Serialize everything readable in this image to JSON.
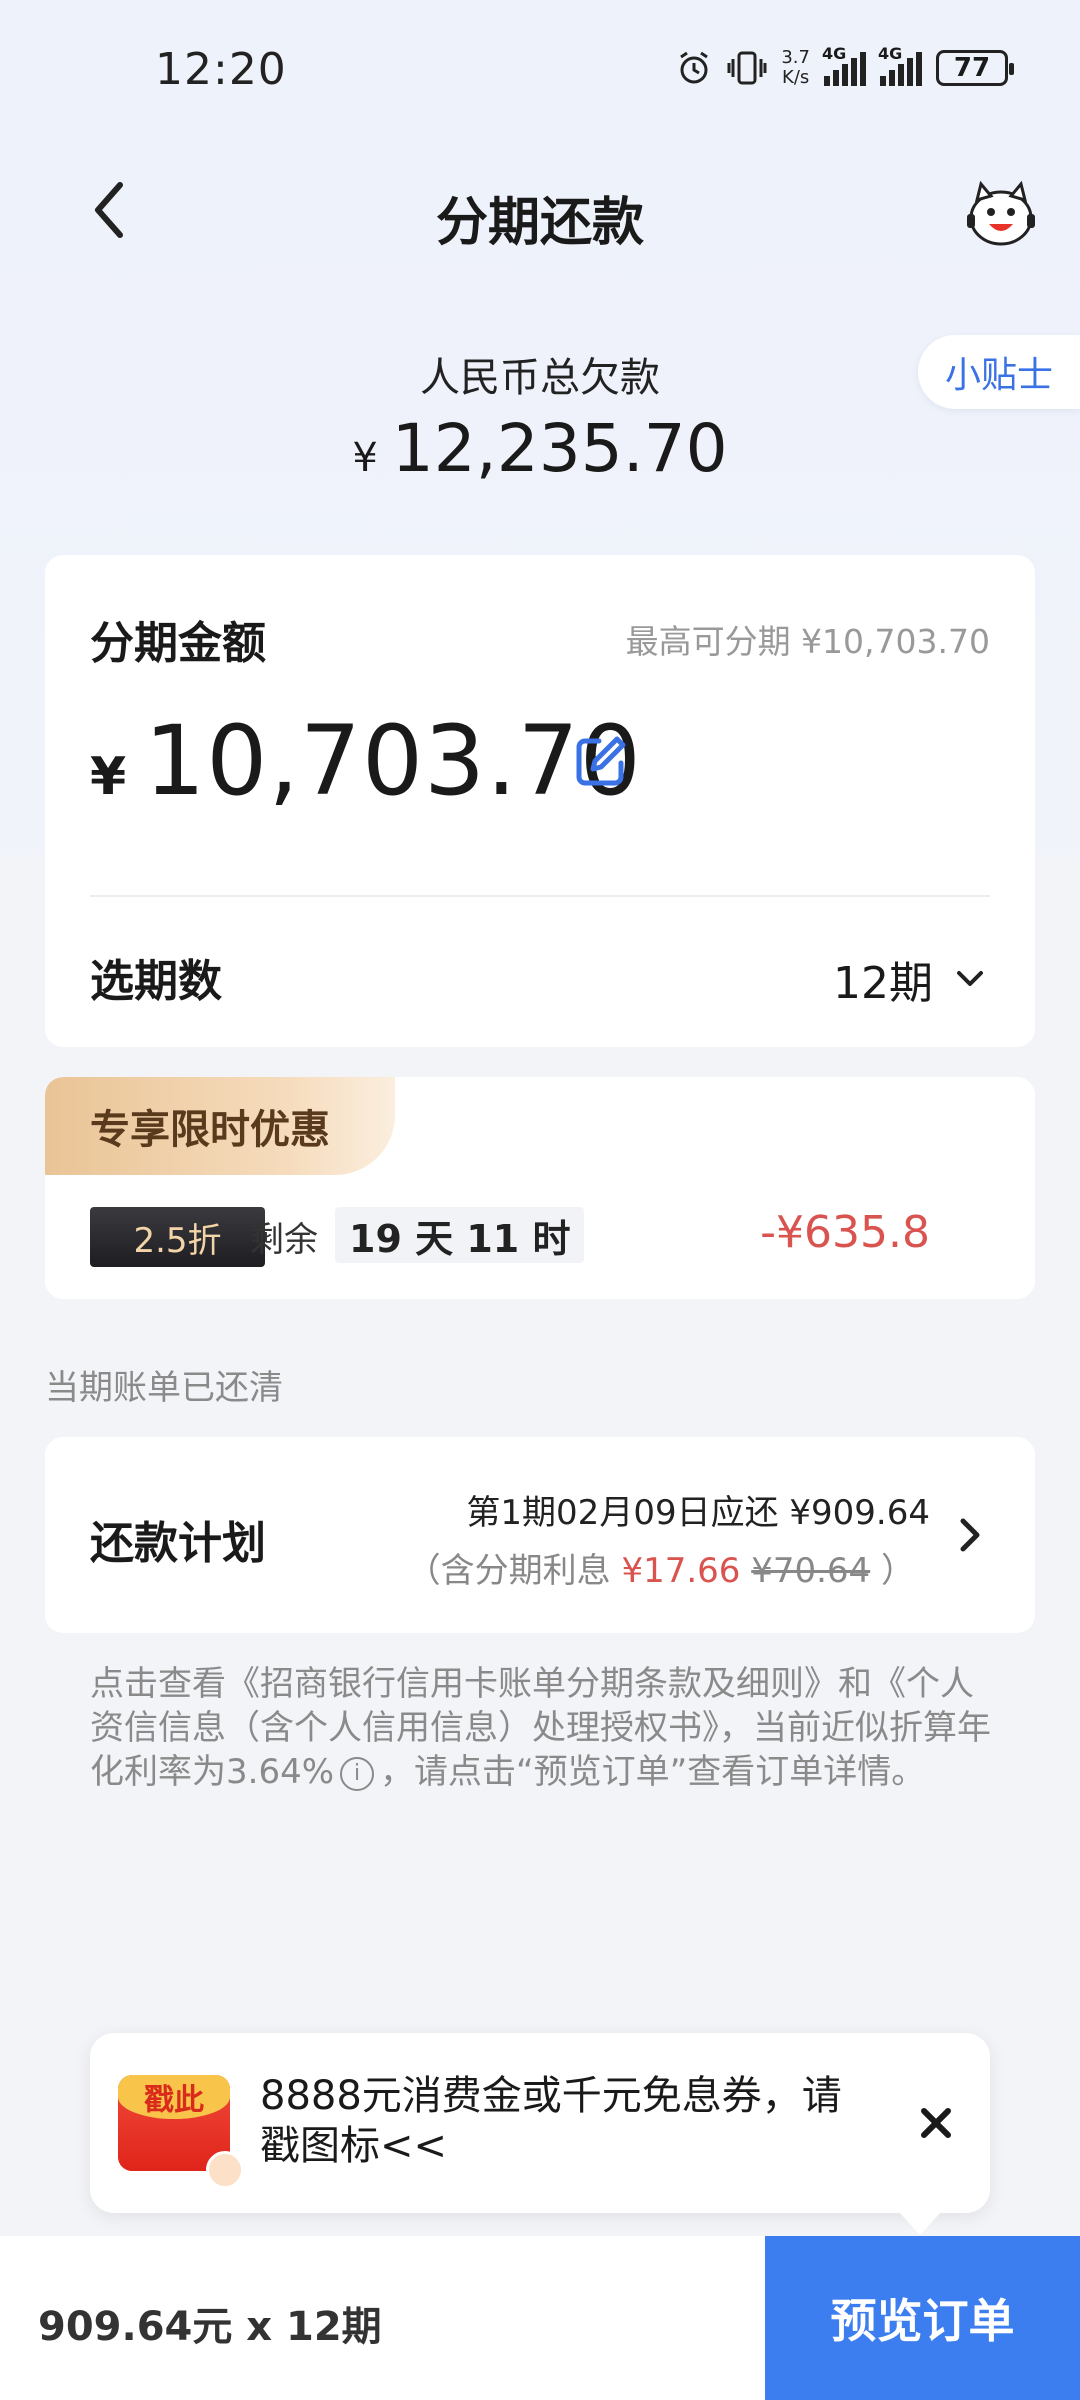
{
  "status_bar": {
    "time": "12:20",
    "net_speed_top": "3.7",
    "net_speed_unit": "K/s",
    "signal1_label": "4G",
    "signal2_label": "4G",
    "battery": "77"
  },
  "header": {
    "title": "分期还款"
  },
  "summary": {
    "debt_label": "人民币总欠款",
    "currency": "¥",
    "debt_amount": "12,235.70",
    "tips_label": "小贴士"
  },
  "installment": {
    "label": "分期金额",
    "max_text": "最高可分期 ¥10,703.70",
    "currency": "¥",
    "amount": "10,703.70",
    "period_label": "选期数",
    "period_value": "12期"
  },
  "promo": {
    "tag": "专享限时优惠",
    "discount": "2.5折",
    "remain_label": "剩余",
    "remain_value": "19 天 11 时",
    "saving": "-¥635.8"
  },
  "bill_note": "当期账单已还清",
  "plan": {
    "label": "还款计划",
    "line1": "第1期02月09日应还 ¥909.64",
    "line2_prefix": "（含分期利息 ",
    "interest": "¥17.66",
    "original_interest": "¥70.64",
    "line2_suffix": " ）"
  },
  "disclaimer": {
    "text_before": "点击查看《招商银行信用卡账单分期条款及细则》和《个人资信信息（含个人信用信息）处理授权书》，当前近似折算年化利率为3.64%",
    "info_icon_glyph": "i",
    "text_after": "，请点击“预览订单”查看订单详情。"
  },
  "banner": {
    "envelope_label": "戳此",
    "text": "8888元消费金或千元免息券，请戳图标<<"
  },
  "bottom_bar": {
    "summary": "909.64元 x 12期",
    "button": "预览订单"
  },
  "colors": {
    "accent_blue": "#3c7ef0",
    "link_blue": "#3a72e6",
    "discount_red": "#d9534f",
    "promo_gold": "#e9c496"
  },
  "icons": [
    "back-icon",
    "mascot-icon",
    "edit-icon",
    "chevron-down-icon",
    "chevron-right-icon",
    "info-icon",
    "close-icon",
    "red-envelope-icon",
    "alarm-icon",
    "vibrate-icon"
  ]
}
